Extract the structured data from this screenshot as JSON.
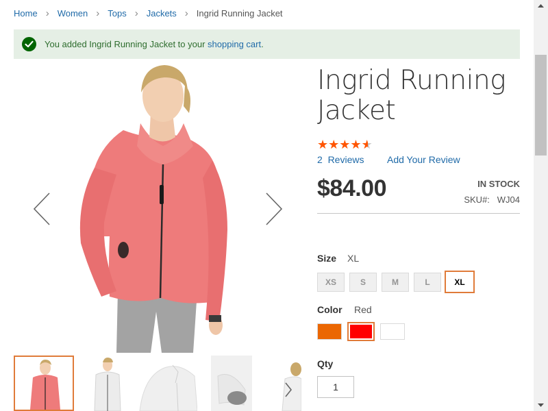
{
  "breadcrumb": {
    "items": [
      "Home",
      "Women",
      "Tops",
      "Jackets"
    ],
    "current": "Ingrid Running Jacket",
    "separator": "›"
  },
  "message": {
    "text_before": "You added Ingrid Running Jacket to your ",
    "link": "shopping cart",
    "text_after": "."
  },
  "product": {
    "title": "Ingrid Running Jacket",
    "rating_stars": 4.5,
    "rating_max": 5,
    "reviews_label": "2  Reviews",
    "add_review_label": "Add Your Review",
    "price": "$84.00",
    "stock": "IN STOCK",
    "sku_label": "SKU#:",
    "sku": "WJ04"
  },
  "size": {
    "label": "Size",
    "selected": "XL",
    "options": [
      "XS",
      "S",
      "M",
      "L",
      "XL"
    ]
  },
  "color": {
    "label": "Color",
    "selected": "Red",
    "swatches": [
      {
        "name": "Orange",
        "hex": "#eb6703"
      },
      {
        "name": "Red",
        "hex": "#ff0000"
      },
      {
        "name": "White",
        "hex": "#ffffff"
      }
    ]
  },
  "qty": {
    "label": "Qty",
    "value": "1"
  },
  "colors": {
    "link": "#1f6aa8",
    "accent": "#e07b39",
    "star": "#ff5501",
    "success_bg": "#e5efe5",
    "success_icon": "#006400"
  }
}
